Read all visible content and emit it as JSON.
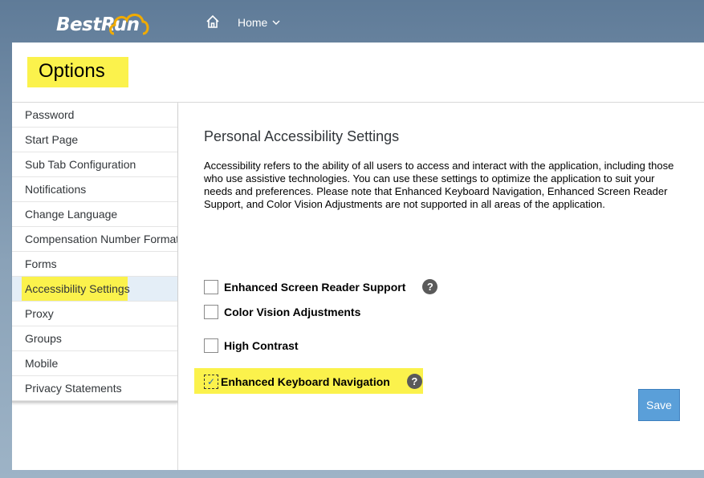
{
  "brand": {
    "logo_text": "BestRun"
  },
  "nav": {
    "home_icon": "home-icon",
    "home_label": "Home"
  },
  "page": {
    "title": "Options"
  },
  "sidebar": {
    "items": [
      {
        "label": "Password"
      },
      {
        "label": "Start Page"
      },
      {
        "label": "Sub Tab Configuration"
      },
      {
        "label": "Notifications"
      },
      {
        "label": "Change Language"
      },
      {
        "label": "Compensation Number Format"
      },
      {
        "label": "Forms"
      },
      {
        "label": "Accessibility Settings",
        "active": true
      },
      {
        "label": "Proxy"
      },
      {
        "label": "Groups"
      },
      {
        "label": "Mobile"
      },
      {
        "label": "Privacy Statements"
      }
    ]
  },
  "content": {
    "heading": "Personal Accessibility Settings",
    "description": "Accessibility refers to the ability of all users to access and interact with the application, including those who use assistive technologies. You can use these settings to optimize the application to suit your needs and preferences. Please note that Enhanced Keyboard Navigation, Enhanced Screen Reader Support, and Color Vision Adjustments are not supported in all areas of the application.",
    "options": {
      "screen_reader": {
        "label": "Enhanced Screen Reader Support",
        "checked": false,
        "help": "?"
      },
      "color_vision": {
        "label": "Color Vision Adjustments",
        "checked": false
      },
      "high_contrast": {
        "label": "High Contrast",
        "checked": false
      },
      "keyboard_nav": {
        "label": "Enhanced Keyboard Navigation",
        "checked": true,
        "check_mark": "✓",
        "help": "?"
      }
    },
    "save_label": "Save"
  },
  "colors": {
    "highlight": "#fbf24c",
    "button": "#5a9fd9",
    "active_row": "#e4eef7"
  }
}
